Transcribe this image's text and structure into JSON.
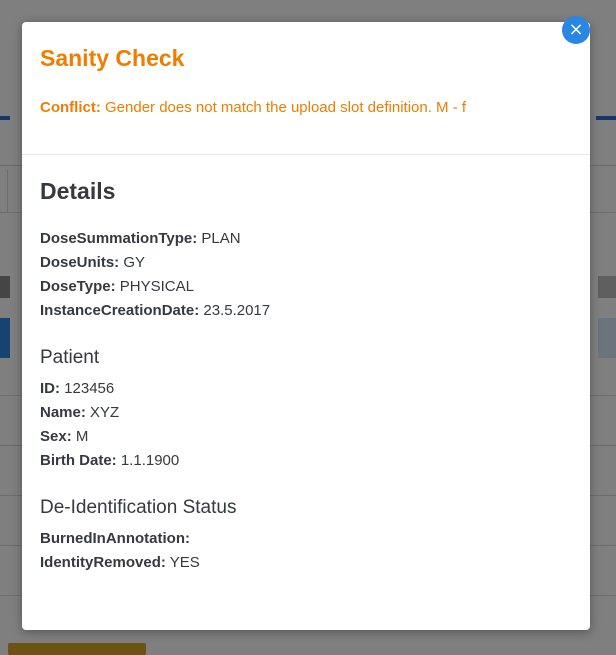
{
  "sanity": {
    "title": "Sanity Check",
    "conflict_label": "Conflict:",
    "conflict_text": "Gender does not match the upload slot definition. M - f"
  },
  "details": {
    "title": "Details",
    "fields": [
      {
        "key": "DoseSummationType:",
        "value": "PLAN"
      },
      {
        "key": "DoseUnits:",
        "value": "GY"
      },
      {
        "key": "DoseType:",
        "value": "PHYSICAL"
      },
      {
        "key": "InstanceCreationDate:",
        "value": "23.5.2017"
      }
    ]
  },
  "patient": {
    "title": "Patient",
    "fields": [
      {
        "key": "ID:",
        "value": "123456"
      },
      {
        "key": "Name:",
        "value": "XYZ"
      },
      {
        "key": "Sex:",
        "value": "M"
      },
      {
        "key": "Birth Date:",
        "value": "1.1.1900"
      }
    ]
  },
  "deid": {
    "title": "De-Identification Status",
    "fields": [
      {
        "key": "BurnedInAnnotation:",
        "value": ""
      },
      {
        "key": "IdentityRemoved:",
        "value": "YES"
      }
    ]
  },
  "close_icon": "×",
  "colors": {
    "accent": "#f07c00",
    "close": "#2a86e3",
    "text": "#343a40"
  }
}
